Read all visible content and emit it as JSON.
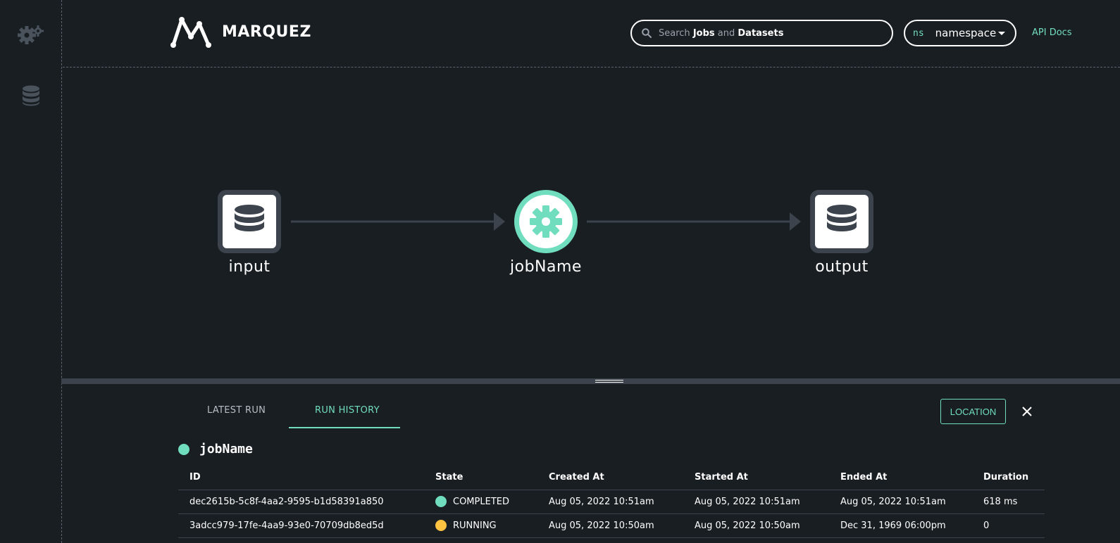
{
  "app": {
    "name": "MARQUEZ"
  },
  "header": {
    "search": {
      "prefix": "Search",
      "jobs": "Jobs",
      "and": "and",
      "datasets": "Datasets"
    },
    "namespace": {
      "prefix": "ns",
      "value": "namespace"
    },
    "api_docs": "API Docs"
  },
  "graph": {
    "nodes": [
      {
        "label": "input",
        "kind": "dataset",
        "icon": "database-icon"
      },
      {
        "label": "jobName",
        "kind": "job",
        "icon": "gear-icon"
      },
      {
        "label": "output",
        "kind": "dataset",
        "icon": "database-icon"
      }
    ]
  },
  "panel": {
    "tabs": [
      {
        "label": "LATEST RUN",
        "active": false
      },
      {
        "label": "RUN HISTORY",
        "active": true
      }
    ],
    "location_label": "LOCATION",
    "job_name": "jobName",
    "job_status_color": "#71ddbf",
    "columns": [
      "ID",
      "State",
      "Created At",
      "Started At",
      "Ended At",
      "Duration"
    ],
    "runs": [
      {
        "id": "dec2615b-5c8f-4aa2-9595-b1d58391a850",
        "state": "COMPLETED",
        "state_color": "#71ddbf",
        "created": "Aug 05, 2022 10:51am",
        "started": "Aug 05, 2022 10:51am",
        "ended": "Aug 05, 2022 10:51am",
        "duration": "618 ms"
      },
      {
        "id": "3adcc979-17fe-4aa9-93e0-70709db8ed5d",
        "state": "RUNNING",
        "state_color": "#fec340",
        "created": "Aug 05, 2022 10:50am",
        "started": "Aug 05, 2022 10:50am",
        "ended": "Dec 31, 1969 06:00pm",
        "duration": "0"
      }
    ]
  },
  "colors": {
    "accent": "#71ddbf",
    "background": "#191e23",
    "running": "#fec340"
  }
}
